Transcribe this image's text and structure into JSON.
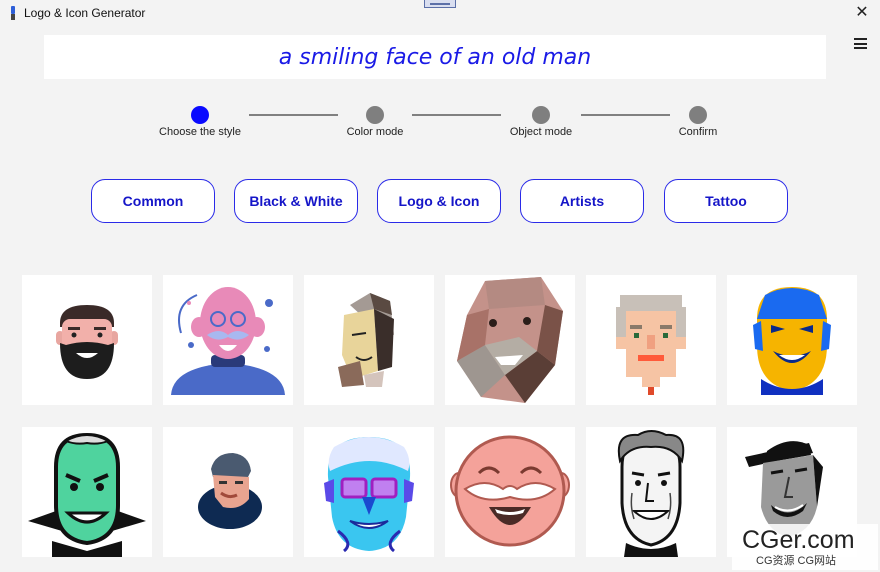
{
  "window": {
    "title": "Logo & Icon Generator",
    "close_glyph": "✕"
  },
  "prompt": {
    "text": "a smiling face of an old man"
  },
  "steps": [
    {
      "label": "Choose the style",
      "active": true
    },
    {
      "label": "Color mode",
      "active": false
    },
    {
      "label": "Object mode",
      "active": false
    },
    {
      "label": "Confirm",
      "active": false
    }
  ],
  "style_buttons": [
    "Common",
    "Black & White",
    "Logo & Icon",
    "Artists",
    "Tattoo"
  ],
  "colors": {
    "accent": "#0a0aff",
    "prompt_text": "#1a1ae6",
    "button_text": "#1515c8",
    "step_inactive": "#7f7f7f"
  },
  "gallery": [
    "bearded-man-icon",
    "pink-bald-man-sweater-icon",
    "cubist-old-man-icon",
    "low-poly-old-man-icon",
    "pixel-old-man-icon",
    "yellow-blue-smiling-man-icon",
    "green-old-man-icon",
    "man-with-cap-icon",
    "blue-man-with-glasses-icon",
    "pink-laughing-old-man-icon",
    "sketch-old-man-icon",
    "black-white-man-with-hat-icon"
  ],
  "watermark": {
    "main": "CGer.com",
    "sub": "CG资源 CG网站"
  }
}
